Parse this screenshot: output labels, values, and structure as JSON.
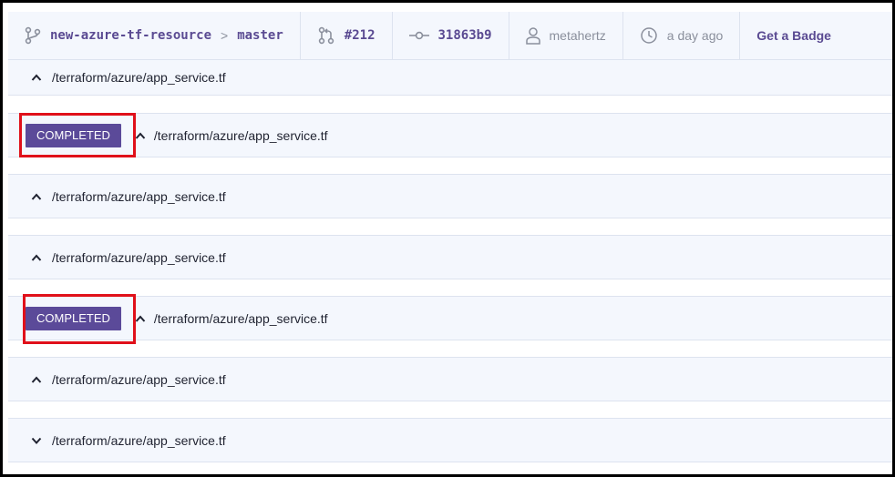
{
  "topbar": {
    "repo": "new-azure-tf-resource",
    "separator": ">",
    "branch": "master",
    "pr": "#212",
    "commit": "31863b9",
    "author": "metahertz",
    "time": "a day ago",
    "badge_link": "Get a Badge"
  },
  "files": [
    {
      "path": "/terraform/azure/app_service.tf",
      "status": "",
      "chevron": "up"
    },
    {
      "path": "/terraform/azure/app_service.tf",
      "status": "COMPLETED",
      "chevron": "up"
    },
    {
      "path": "/terraform/azure/app_service.tf",
      "status": "",
      "chevron": "up"
    },
    {
      "path": "/terraform/azure/app_service.tf",
      "status": "",
      "chevron": "up"
    },
    {
      "path": "/terraform/azure/app_service.tf",
      "status": "COMPLETED",
      "chevron": "up"
    },
    {
      "path": "/terraform/azure/app_service.tf",
      "status": "",
      "chevron": "up"
    },
    {
      "path": "/terraform/azure/app_service.tf",
      "status": "",
      "chevron": "down"
    }
  ],
  "colors": {
    "accent": "#5b4a99",
    "highlight": "#e0101a",
    "row_bg": "#f4f7fd"
  }
}
